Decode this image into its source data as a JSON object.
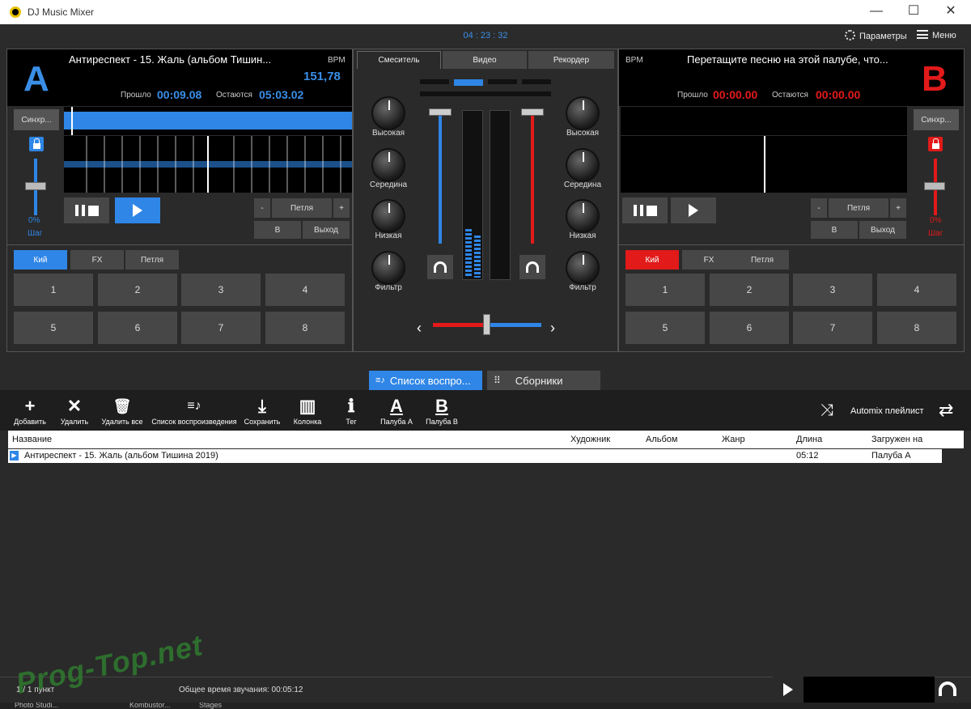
{
  "app": {
    "title": "DJ Music Mixer"
  },
  "topbar": {
    "clock": "04 : 23 : 32",
    "settings_label": "Параметры",
    "menu_label": "Меню"
  },
  "deckA": {
    "letter": "A",
    "track": "Антиреспект - 15. Жаль (альбом Тишин...",
    "bpm_label": "BPM",
    "bpm": "151,78",
    "elapsed_label": "Прошло",
    "elapsed": "00:09.08",
    "remain_label": "Остаются",
    "remain": "05:03.02",
    "sync": "Синхр...",
    "pitch_value": "0%",
    "pitch_label": "Шаг",
    "loop_minus": "-",
    "loop": "Петля",
    "loop_plus": "+",
    "loop_in": "B",
    "loop_out": "Выход",
    "tabs": [
      "Кий",
      "FX",
      "Петля"
    ],
    "pads": [
      "1",
      "2",
      "3",
      "4",
      "5",
      "6",
      "7",
      "8"
    ],
    "color": "#2f86e6"
  },
  "deckB": {
    "letter": "B",
    "track": "Перетащите песню на этой палубе, что...",
    "bpm_label": "BPM",
    "elapsed_label": "Прошло",
    "elapsed": "00:00.00",
    "remain_label": "Остаются",
    "remain": "00:00.00",
    "sync": "Синхр...",
    "pitch_value": "0%",
    "pitch_label": "Шаг",
    "loop_minus": "-",
    "loop": "Петля",
    "loop_plus": "+",
    "loop_in": "B",
    "loop_out": "Выход",
    "tabs": [
      "Кий",
      "FX",
      "Петля"
    ],
    "pads": [
      "1",
      "2",
      "3",
      "4",
      "5",
      "6",
      "7",
      "8"
    ],
    "color": "#e21a1a"
  },
  "mixer": {
    "tabs": [
      "Смеситель",
      "Видео",
      "Рекордер"
    ],
    "knobs": [
      "Высокая",
      "Середина",
      "Низкая",
      "Фильтр"
    ]
  },
  "browser": {
    "tabs": [
      "Список воспро...",
      "Сборники"
    ],
    "toolbar": [
      {
        "glyph": "+",
        "label": "Добавить"
      },
      {
        "glyph": "✕",
        "label": "Удалить"
      },
      {
        "glyph": "🗑",
        "label": "Удалить все"
      },
      {
        "glyph": "≡♪",
        "label": "Список воспроизведения"
      },
      {
        "glyph": "⤓",
        "label": "Сохранить"
      },
      {
        "glyph": "▥",
        "label": "Колонка"
      },
      {
        "glyph": "ℹ",
        "label": "Тег"
      },
      {
        "glyph": "A",
        "label": "Палуба A"
      },
      {
        "glyph": "B",
        "label": "Палуба B"
      }
    ],
    "automix": "Automix плейлист"
  },
  "table": {
    "columns": [
      "Название",
      "Художник",
      "Альбом",
      "Жанр",
      "Длина",
      "Загружен на"
    ],
    "rows": [
      {
        "title": "Антиреспект - 15. Жаль (альбом Тишина 2019)",
        "length": "05:12",
        "loaded": "Палуба A"
      }
    ]
  },
  "status": {
    "count": "1 / 1 пункт",
    "total": "Общее время звучания: 00:05:12"
  },
  "taskbar": [
    "Photo Studi...",
    "Kombustor...",
    "Stages"
  ],
  "watermark": "Prog-Top.net"
}
